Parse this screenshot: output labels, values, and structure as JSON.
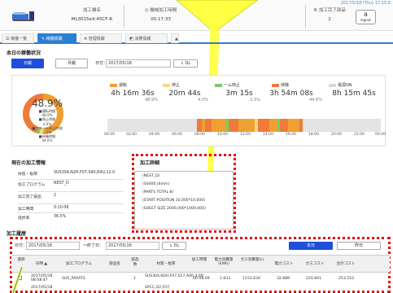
{
  "header": {
    "datetime": "2017/5/18 (Thu) 17:15:0",
    "machine_name_label": "加工機名",
    "machine_name_value": "ML3015eX-45CF-R",
    "run_time_label": "機械加工時間",
    "run_time_value": "00:17:33",
    "done_parts_label": "加工完了部品",
    "done_parts_value": "2",
    "logout_label": "logout"
  },
  "tabs": [
    {
      "label": "稼働一覧"
    },
    {
      "label": "稼働情報"
    },
    {
      "label": "管理情報"
    },
    {
      "label": "消費情報"
    },
    {
      "label": "▲"
    }
  ],
  "status": {
    "title": "本日の稼働状況",
    "btn_daily": "日報",
    "btn_monthly": "月報",
    "date_label": "日付：",
    "date_value": "2017/05/18",
    "dl_label": "↓ DL",
    "legend": [
      {
        "label": "運転",
        "color": "#f0a030"
      },
      {
        "label": "停止",
        "color": "#f7d88a"
      },
      {
        "label": "ーム停止",
        "color": "#7ec86a"
      },
      {
        "label": "待機",
        "color": "#f07a3a"
      },
      {
        "label": "電源ON",
        "color": "#d8d8d8"
      }
    ],
    "stats": [
      {
        "time": "4h 16m 36s",
        "pct": "48.9%"
      },
      {
        "time": "20m 44s",
        "pct": "4.0%"
      },
      {
        "time": "3m 15s",
        "pct": "2.5%"
      },
      {
        "time": "3h 54m 08s",
        "pct": "44.6%"
      },
      {
        "time": "8h 15m 45s",
        "pct": ""
      }
    ],
    "timeline_ticks": [
      "00:00",
      "02:00",
      "04:00",
      "06:00",
      "08:00",
      "10:00",
      "12:00",
      "14:00",
      "16:00",
      "18:00",
      "20:00",
      "22:00",
      "00:00"
    ],
    "donut": {
      "center_pct": "48.9%",
      "lines": [
        "■運転時間",
        "48.9%",
        "■停止時間",
        "4.0%",
        "■アラーム停止時間",
        "2.5%",
        "■待機時間",
        "44.6%"
      ]
    }
  },
  "current": {
    "title": "現在の加工情報",
    "rows": [
      {
        "k": "材質・板厚",
        "v": "SUS304,N2H,F07,S40,R4U,12.0"
      },
      {
        "k": "加工プログラム",
        "v": "NEST_D"
      },
      {
        "k": "加工完了部品",
        "v": "2"
      },
      {
        "k": "加工時間",
        "v": "0:10:06"
      },
      {
        "k": "進捗率",
        "v": "36.5%"
      }
    ]
  },
  "detail": {
    "title": "加工詳細",
    "lines": [
      "(NEST_D)",
      "(SS400,(6mm)",
      "(PARTS TOTAL 8)",
      "(START POSITION 10,000*10,000)",
      "(SHEET SIZE 2000,000*1000,000)"
    ]
  },
  "history": {
    "title": "加工履歴",
    "date_from_label": "日付：",
    "date_from": "2017/05/18",
    "date_to_label": "～終了日：",
    "date_to": "2017/05/18",
    "dl_label": "↓ DL",
    "btn_today": "本日",
    "btn_yesterday": "昨日",
    "columns": [
      "選択",
      "日時 ▲",
      "加工プログラム",
      "部品名",
      "部品数",
      "材質・板厚",
      "加工時間",
      "電力消費量(kWh)",
      "ガス消費量(L)",
      "電力コスト",
      "ガスコスト",
      "合計コスト"
    ],
    "rows": [
      [
        "",
        "2017/05/18 08:08:47",
        "SUS_PARATS",
        "",
        "1",
        "SUS304,N2H,F07,S17,A00,3.0D",
        "00:08:09",
        "1.633",
        "1153.634",
        "32.889",
        "220.841",
        "253.510"
      ],
      [
        "",
        "2017/05/18",
        "",
        "",
        "",
        "SPCC,O2,F07,",
        "",
        "",
        "",
        "",
        "",
        ""
      ]
    ]
  }
}
